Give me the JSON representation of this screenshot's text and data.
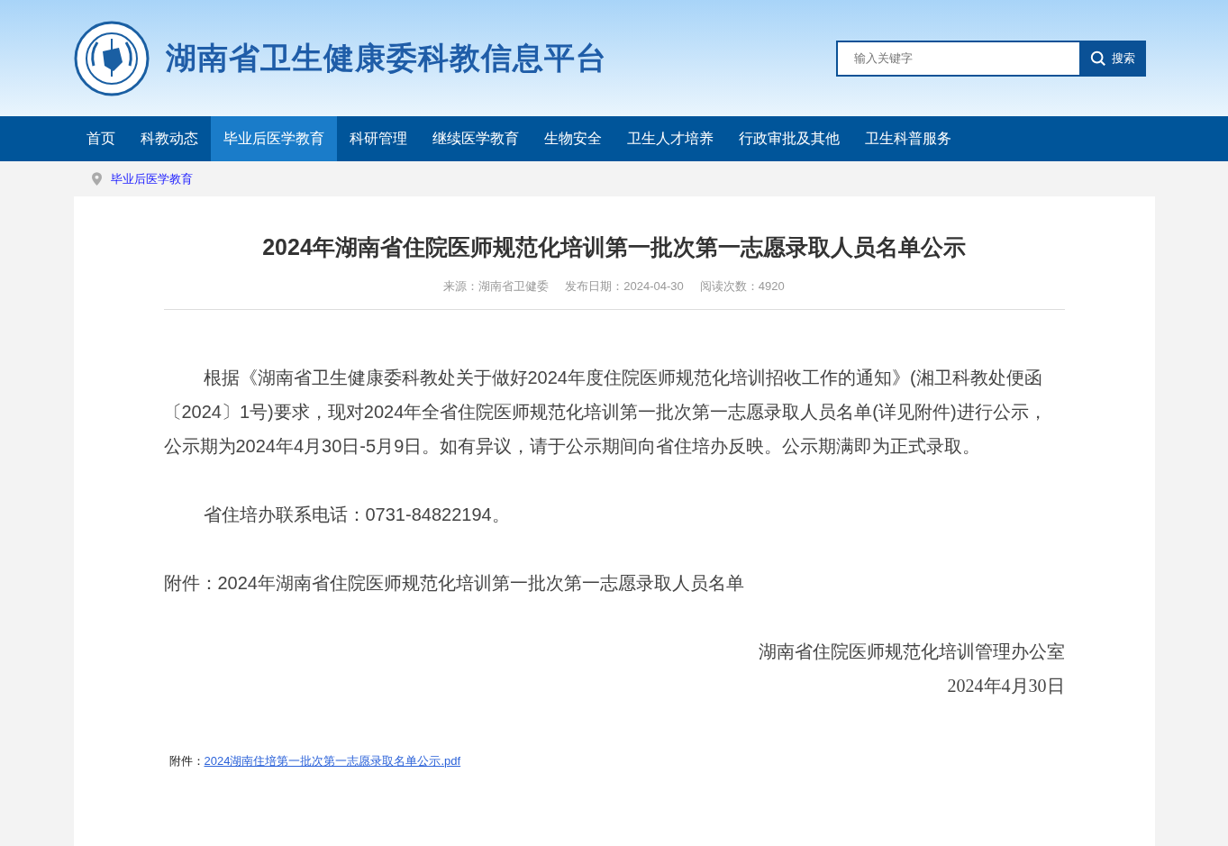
{
  "header": {
    "site_title": "湖南省卫生健康委科教信息平台",
    "search": {
      "placeholder": "输入关键字",
      "button": "搜索"
    }
  },
  "nav": [
    {
      "label": "首页",
      "selected": false
    },
    {
      "label": "科教动态",
      "selected": false
    },
    {
      "label": "毕业后医学教育",
      "selected": true
    },
    {
      "label": "科研管理",
      "selected": false
    },
    {
      "label": "继续医学教育",
      "selected": false
    },
    {
      "label": "生物安全",
      "selected": false
    },
    {
      "label": "卫生人才培养",
      "selected": false
    },
    {
      "label": "行政审批及其他",
      "selected": false
    },
    {
      "label": "卫生科普服务",
      "selected": false
    }
  ],
  "breadcrumb": [
    "毕业后医学教育"
  ],
  "article": {
    "title": "2024年湖南省住院医师规范化培训第一批次第一志愿录取人员名单公示",
    "meta": [
      "来源：湖南省卫健委",
      "发布日期：2024-04-30",
      "阅读次数：4920"
    ],
    "paragraphs": [
      {
        "kind": "indent",
        "text": "根据《湖南省卫生健康委科教处关于做好2024年度住院医师规范化培训招收工作的通知》(湘卫科教处便函〔2024〕1号)要求，现对2024年全省住院医师规范化培训第一批次第一志愿录取人员名单(详见附件)进行公示，公示期为2024年4月30日-5月9日。如有异议，请于公示期间向省住培办反映。公示期满即为正式录取。"
      },
      {
        "kind": "indent",
        "text": "省住培办联系电话：0731-84822194。"
      },
      {
        "kind": "plain",
        "text": "附件：2024年湖南省住院医师规范化培训第一批次第一志愿录取人员名单"
      },
      {
        "kind": "right",
        "text": "湖南省住院医师规范化培训管理办公室"
      },
      {
        "kind": "right-serif",
        "text": "2024年4月30日"
      }
    ],
    "attachment": {
      "label": "附件：",
      "link": "2024湖南住培第一批次第一志愿录取名单公示.pdf"
    }
  }
}
